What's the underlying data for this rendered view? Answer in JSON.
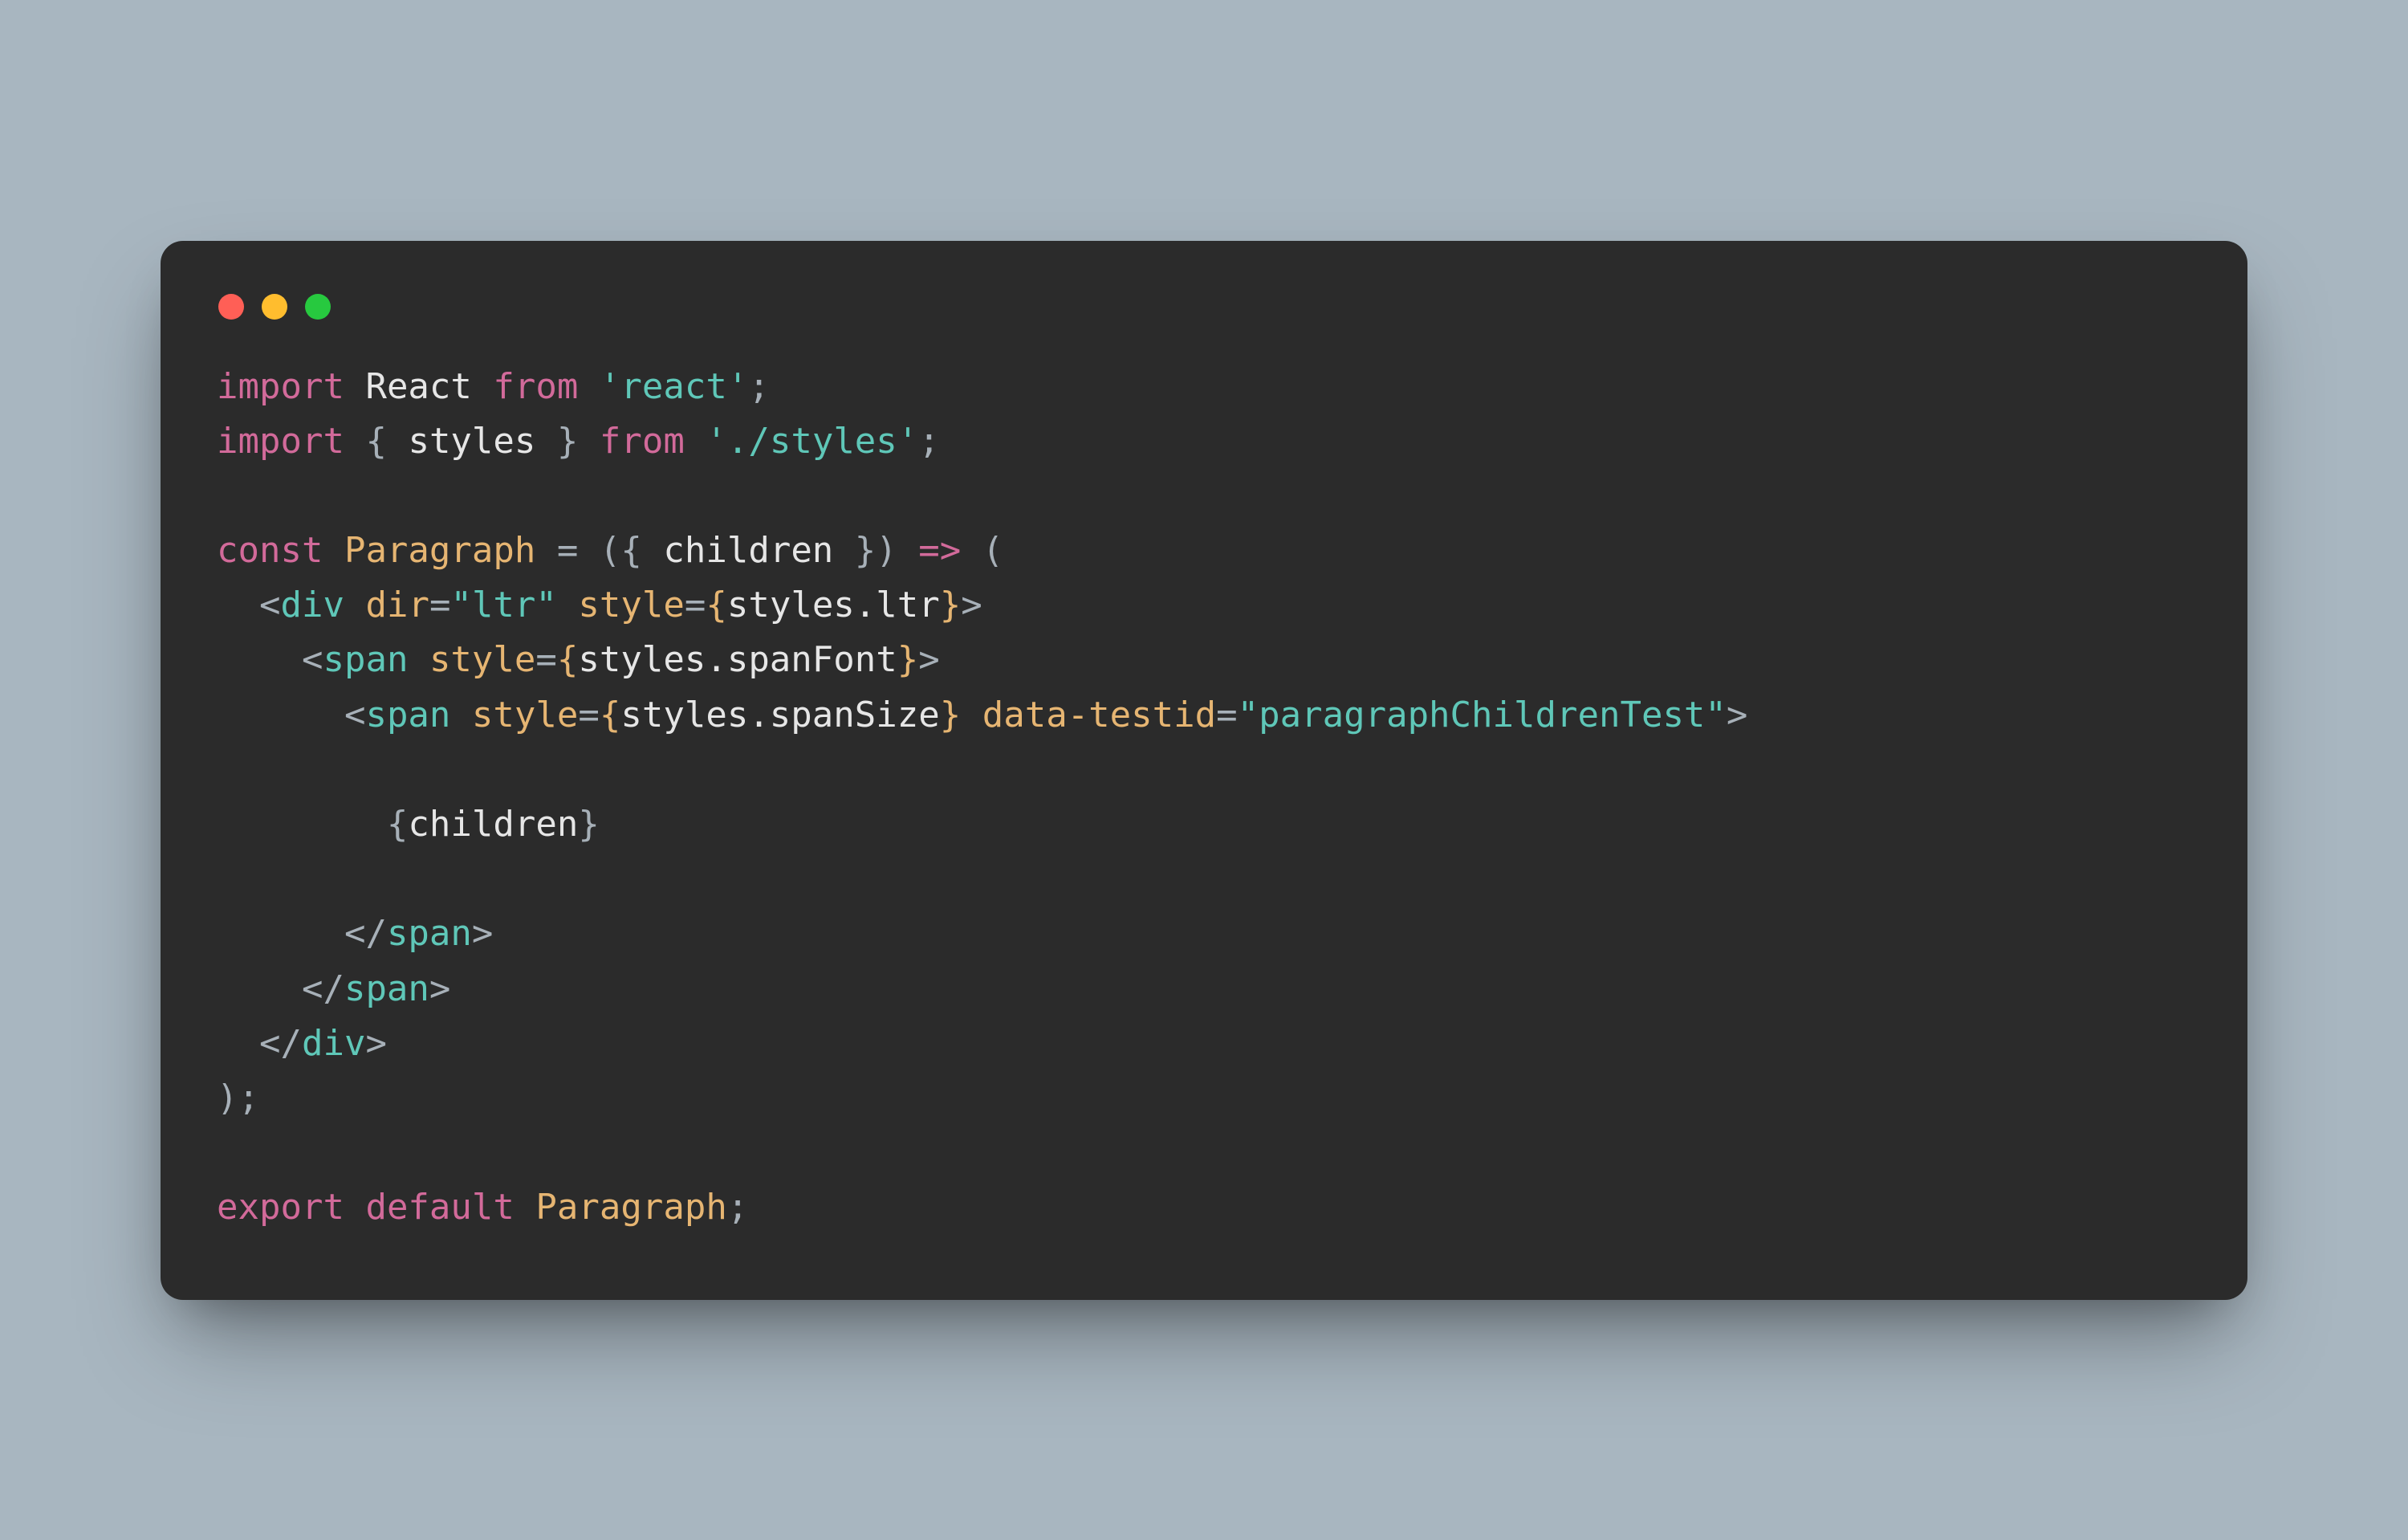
{
  "window": {
    "traffic_lights": [
      "close",
      "minimize",
      "zoom"
    ]
  },
  "code": {
    "line1": {
      "kw1": "import",
      "id1": "React",
      "kw2": "from",
      "str1": "'react'",
      "semi": ";"
    },
    "line2": {
      "kw1": "import",
      "brace_open": "{",
      "id1": "styles",
      "brace_close": "}",
      "kw2": "from",
      "str1": "'./styles'",
      "semi": ";"
    },
    "line3": "",
    "line4": {
      "kw1": "const",
      "fn": "Paragraph",
      "eq": "=",
      "paren_open": "(",
      "brace_open": "{",
      "id1": "children",
      "brace_close": "}",
      "paren_close": ")",
      "arrow": "=>",
      "paren2": "("
    },
    "line5": {
      "indent": "  ",
      "ao": "<",
      "tag": "div",
      "sp": " ",
      "attr1": "dir",
      "eq": "=",
      "val1": "\"ltr\"",
      "sp2": " ",
      "attr2": "style",
      "eq2": "=",
      "bo": "{",
      "expr": "styles.ltr",
      "bc": "}",
      "ac": ">"
    },
    "line6": {
      "indent": "    ",
      "ao": "<",
      "tag": "span",
      "sp": " ",
      "attr1": "style",
      "eq": "=",
      "bo": "{",
      "expr": "styles.spanFont",
      "bc": "}",
      "ac": ">"
    },
    "line7": {
      "indent": "      ",
      "ao": "<",
      "tag": "span",
      "sp": " ",
      "attr1": "style",
      "eq": "=",
      "bo": "{",
      "expr": "styles.spanSize",
      "bc": "}",
      "sp2": " ",
      "attr2": "data-testid",
      "eq2": "=",
      "val2": "\"paragraphChildrenTest\"",
      "ac": ">"
    },
    "line8": "",
    "line9": {
      "indent": "        ",
      "bo": "{",
      "id": "children",
      "bc": "}"
    },
    "line10": "",
    "line11": {
      "indent": "      ",
      "ao": "</",
      "tag": "span",
      "ac": ">"
    },
    "line12": {
      "indent": "    ",
      "ao": "</",
      "tag": "span",
      "ac": ">"
    },
    "line13": {
      "indent": "  ",
      "ao": "</",
      "tag": "div",
      "ac": ">"
    },
    "line14": {
      "paren": ")",
      "semi": ";"
    },
    "line15": "",
    "line16": {
      "kw1": "export",
      "kw2": "default",
      "fn": "Paragraph",
      "semi": ";"
    }
  }
}
